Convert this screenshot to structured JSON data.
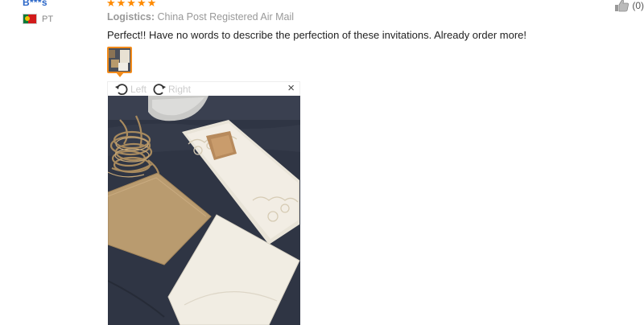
{
  "review": {
    "buyer_name": "B***s",
    "country_code": "PT",
    "rating": "★★★★★",
    "logistics_label": "Logistics:",
    "logistics_value": "China Post Registered Air Mail",
    "text": "Perfect!! Have no words to describe the perfection of these invitations. Already order more!",
    "helpful_count": "(0)"
  },
  "viewer": {
    "rotate_left_label": "Left",
    "rotate_right_label": "Right",
    "close_symbol": "×"
  },
  "icons": {
    "thumbs_up": "thumbs-up-icon",
    "rotate_left": "rotate-left-icon",
    "rotate_right": "rotate-right-icon",
    "close": "close-icon",
    "flag": "portugal-flag-icon"
  },
  "colors": {
    "star": "#ff8a00",
    "thumb_border": "#f28b1b",
    "buyer_link": "#2a66c8"
  }
}
